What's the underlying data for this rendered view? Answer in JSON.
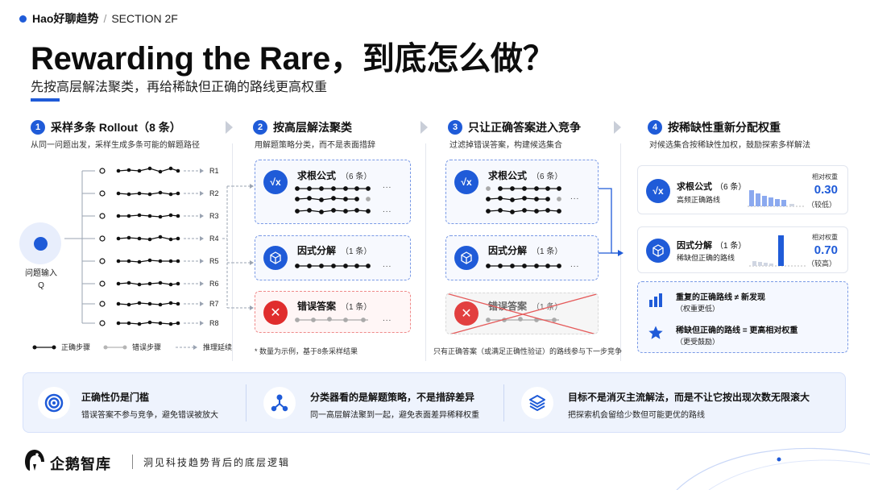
{
  "header": {
    "brand": "Hao好聊趋势",
    "separator": "/",
    "section": "SECTION 2F"
  },
  "title": "Rewarding the Rare，到底怎么做？",
  "subtitle": "先按高层解法聚类，再给稀缺但正确的路线更高权重",
  "steps": [
    {
      "num": "1",
      "title": "采样多条 Rollout（8 条）",
      "desc": "从同一问题出发，采样生成多条可能的解题路径"
    },
    {
      "num": "2",
      "title": "按高层解法聚类",
      "desc": "用解题策略分类，而不是表面措辞"
    },
    {
      "num": "3",
      "title": "只让正确答案进入竞争",
      "desc": "过滤掉错误答案，构建候选集合"
    },
    {
      "num": "4",
      "title": "按稀缺性重新分配权重",
      "desc": "对候选集合按稀缺性加权，鼓励探索多样解法"
    }
  ],
  "column1": {
    "input_label": "问题输入",
    "input_symbol": "Q",
    "rollouts": [
      "R1",
      "R2",
      "R3",
      "R4",
      "R5",
      "R6",
      "R7",
      "R8"
    ],
    "legend": {
      "correct": "正确步骤",
      "wrong": "错误步骤",
      "deduce": "推理延续"
    }
  },
  "column2": {
    "clusters": [
      {
        "icon": "√x",
        "name": "求根公式",
        "count": "（6 条）",
        "more": "..."
      },
      {
        "icon": "cube",
        "name": "因式分解",
        "count": "（1 条）",
        "more": "..."
      },
      {
        "icon": "✕",
        "name": "错误答案",
        "count": "（1 条）",
        "more": "..."
      }
    ],
    "note": "* 数量为示例，基于8条采样结果"
  },
  "column3": {
    "clusters": [
      {
        "icon": "√x",
        "name": "求根公式",
        "count": "（6 条）",
        "more": "..."
      },
      {
        "icon": "cube",
        "name": "因式分解",
        "count": "（1 条）",
        "more": "..."
      },
      {
        "icon": "✕",
        "name": "错误答案",
        "count": "（1 条）"
      }
    ],
    "note": "只有正确答案（或满足正确性验证）的路线参与下一步竞争"
  },
  "column4": {
    "cards": [
      {
        "icon": "√x",
        "name": "求根公式",
        "count": "（6 条）",
        "sub": "高频正确路线",
        "weight_label": "相对权重",
        "weight": "0.30",
        "level": "（较低）"
      },
      {
        "icon": "cube",
        "name": "因式分解",
        "count": "（1 条）",
        "sub": "稀缺但正确的路线",
        "weight_label": "相对权重",
        "weight": "0.70",
        "level": "（较高）"
      }
    ],
    "summary": [
      {
        "icon": "bar-chart-icon",
        "title": "重复的正确路线  ≠  新发现",
        "sub": "（权重更低）"
      },
      {
        "icon": "star-icon",
        "title": "稀缺但正确的路线  =  更高相对权重",
        "sub": "（更受鼓励）"
      }
    ]
  },
  "bottom": [
    {
      "icon": "target-icon",
      "title": "正确性仍是门槛",
      "desc": "错误答案不参与竞争，避免错误被放大"
    },
    {
      "icon": "network-icon",
      "title": "分类器看的是解题策略，不是措辞差异",
      "desc": "同一高层解法聚到一起，避免表面差异稀释权重"
    },
    {
      "icon": "layers-icon",
      "title": "目标不是消灭主流解法，而是不让它按出现次数无限滚大",
      "desc": "把探索机会留给少数但可能更优的路线"
    }
  ],
  "footer": {
    "brand": "企鹅智库",
    "tagline": "洞见科技趋势背后的底层逻辑"
  },
  "colors": {
    "accent": "#1f5bd8",
    "error": "#e02d2d",
    "muted": "#a9a9a9"
  }
}
